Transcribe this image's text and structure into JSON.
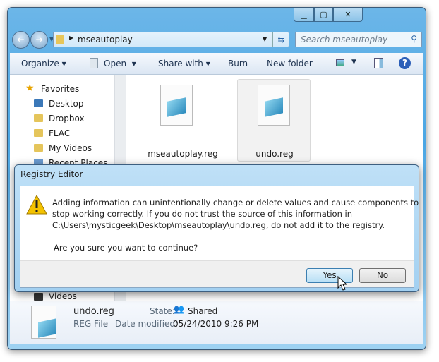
{
  "explorer": {
    "address": {
      "path": "mseautoplay"
    },
    "search": {
      "placeholder": "Search mseautoplay"
    },
    "toolbar": {
      "organize": "Organize",
      "open": "Open",
      "share_with": "Share with",
      "burn": "Burn",
      "new_folder": "New folder"
    },
    "nav": {
      "favorites": "Favorites",
      "items": [
        {
          "label": "Desktop",
          "icon": "desktop-icon"
        },
        {
          "label": "Dropbox",
          "icon": "folder-icon"
        },
        {
          "label": "FLAC",
          "icon": "folder-icon"
        },
        {
          "label": "My Videos",
          "icon": "folder-icon"
        },
        {
          "label": "Recent Places",
          "icon": "recent-places-icon"
        }
      ],
      "videos": "Videos"
    },
    "files": [
      {
        "name": "mseautoplay.reg"
      },
      {
        "name": "undo.reg",
        "selected": true
      }
    ],
    "details": {
      "name": "undo.reg",
      "type": "REG File",
      "state_label": "State:",
      "state_value": "Shared",
      "date_label": "Date modified:",
      "date_value": "05/24/2010 9:26 PM"
    }
  },
  "dialog": {
    "title": "Registry Editor",
    "icon": "warning-icon",
    "message_lines": [
      "Adding information can unintentionally change or delete values and cause components to",
      "stop working correctly. If you do not trust the source of this information in",
      "C:\\Users\\mysticgeek\\Desktop\\mseautoplay\\undo.reg, do not add it to the registry."
    ],
    "question": "Are you sure you want to continue?",
    "yes": "Yes",
    "no": "No"
  },
  "colors": {
    "glass": "#4aa6e4",
    "default_button": "#b8dff5",
    "warning": "#f3c200"
  }
}
